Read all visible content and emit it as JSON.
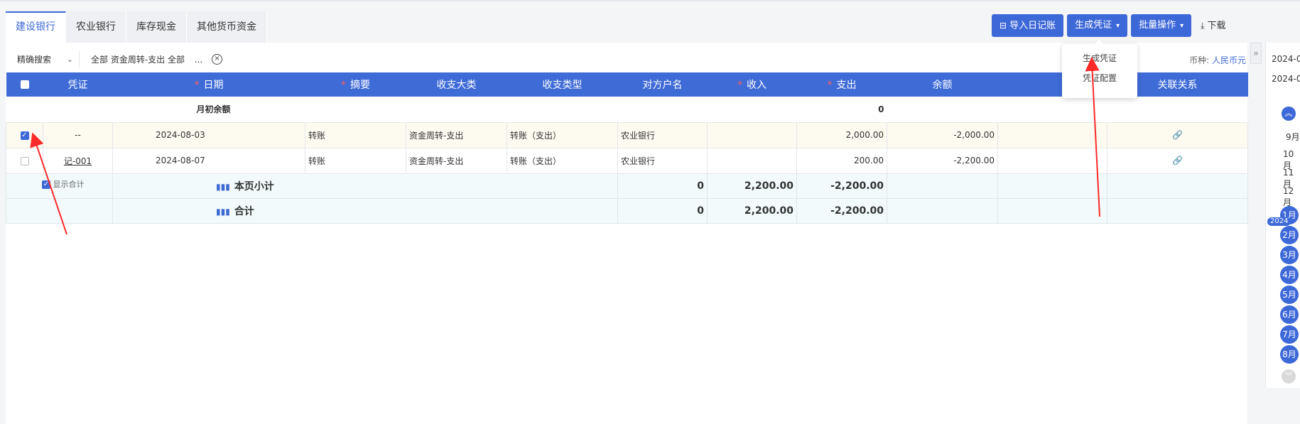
{
  "tabs": [
    {
      "label": "建设银行",
      "active": true
    },
    {
      "label": "农业银行",
      "active": false
    },
    {
      "label": "库存现金",
      "active": false
    },
    {
      "label": "其他货币资金",
      "active": false
    }
  ],
  "toolbar": {
    "import_label": "导入日记账",
    "generate_label": "生成凭证",
    "batch_label": "批量操作",
    "download_label": "下载"
  },
  "dropdown": {
    "items": [
      "生成凭证",
      "凭证配置"
    ]
  },
  "filter": {
    "mode": "精确搜索",
    "criteria": "全部 资金周转-支出  全部",
    "more": "...",
    "currency_label": "币种:",
    "currency_value": "人民币元"
  },
  "table": {
    "headers": [
      "凭证",
      "日期",
      "摘要",
      "收支大类",
      "收支类型",
      "对方户名",
      "收入",
      "支出",
      "余额",
      "",
      "关联关系"
    ],
    "required": [
      false,
      true,
      true,
      false,
      false,
      false,
      true,
      true,
      false,
      false,
      false
    ],
    "opening": {
      "label": "月初余额",
      "balance": "0"
    },
    "rows": [
      {
        "checked": true,
        "voucher": "--",
        "date": "2024-08-03",
        "summary": "转账",
        "category": "资金周转-支出",
        "type": "转账（支出）",
        "counterparty": "农业银行",
        "income": "",
        "expense": "2,000.00",
        "balance": "-2,000.00"
      },
      {
        "checked": false,
        "voucher": "记-001",
        "date": "2024-08-07",
        "summary": "转账",
        "category": "资金周转-支出",
        "type": "转账（支出）",
        "counterparty": "农业银行",
        "income": "",
        "expense": "200.00",
        "balance": "-2,200.00"
      }
    ],
    "show_total_label": "显示合计",
    "subtotal": {
      "label": "本页小计",
      "income": "0",
      "expense": "2,200.00",
      "balance": "-2,200.00"
    },
    "total": {
      "label": "合计",
      "income": "0",
      "expense": "2,200.00",
      "balance": "-2,200.00"
    }
  },
  "sidepanel": {
    "dates": [
      "2024-0",
      "2024-0"
    ],
    "months_plain": [
      "9月",
      "10月",
      "11月",
      "12月"
    ],
    "year_badge": "2024",
    "months_active": [
      "1月",
      "2月",
      "3月",
      "4月",
      "5月",
      "6月",
      "7月",
      "8月"
    ]
  },
  "colors": {
    "accent": "#3d68d8",
    "header": "#3f6bd7",
    "annotation": "#ff2a2a"
  },
  "icons": [
    "import-icon",
    "chevron-down-icon",
    "download-icon",
    "clear-circle-icon",
    "link-icon",
    "bar-chart-icon",
    "chevron-up-circle-icon",
    "chevron-down-circle-icon",
    "collapse-arrows-icon"
  ]
}
